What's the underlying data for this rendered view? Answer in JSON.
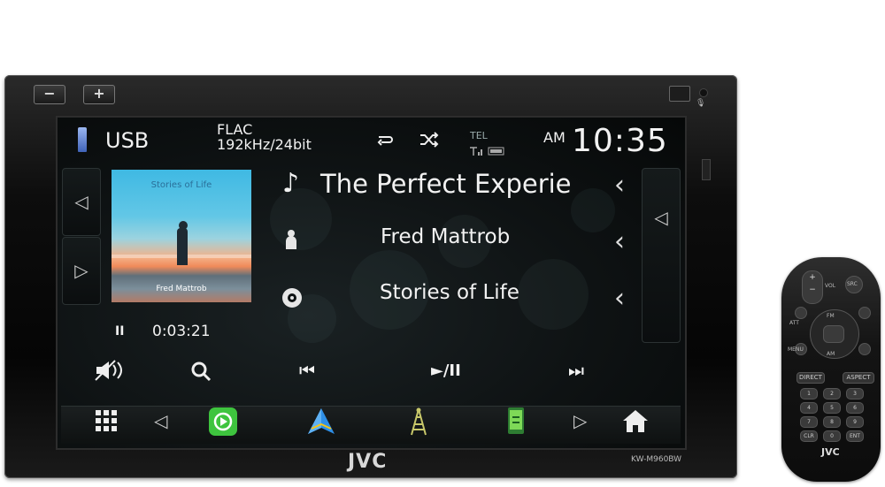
{
  "unit": {
    "brand": "JVC",
    "model": "KW-M960BW",
    "vol_minus": "−",
    "vol_plus": "+"
  },
  "status": {
    "source": "USB",
    "format": "FLAC",
    "quality": "192kHz/24bit",
    "tel_label": "TEL",
    "ampm": "AM",
    "time": "10:35"
  },
  "track": {
    "title": "The Perfect Experie",
    "artist": "Fred Mattrob",
    "album": "Stories of Life",
    "elapsed": "0:03:21",
    "art_title": "Stories of Life",
    "art_artist": "Fred Mattrob"
  },
  "glyphs": {
    "left_arrow": "◁",
    "right_arrow": "▷",
    "chevron_left": "‹",
    "note": "♪",
    "pause": "II",
    "prev": "⏮",
    "playpause": "►/II",
    "next": "⏭",
    "home": "⌂"
  },
  "remote": {
    "vol": "VOL",
    "src": "SRC",
    "att": "ATT",
    "menu": "MENU",
    "fm": "FM",
    "am": "AM",
    "direct": "DIRECT",
    "aspect": "ASPECT",
    "clr": "CLR",
    "ent": "ENT",
    "brand": "JVC",
    "keys": [
      "1",
      "2",
      "3",
      "4",
      "5",
      "6",
      "7",
      "8",
      "9",
      "CLR",
      "0",
      "ENT"
    ]
  },
  "colors": {
    "carplay": "#3ec43e",
    "android_auto_blue": "#2f8fe6",
    "android_auto_yellow": "#f5c518",
    "usb_icon": "#6a8fd8"
  }
}
